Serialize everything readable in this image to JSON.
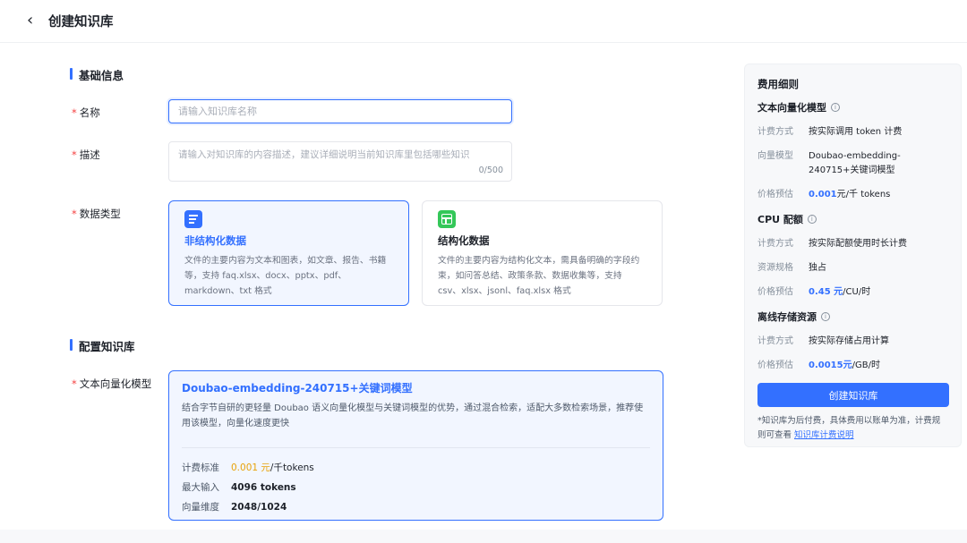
{
  "header": {
    "back_icon": "chevron-left-icon",
    "title": "创建知识库"
  },
  "basic_section": {
    "title": "基础信息"
  },
  "name_field": {
    "label": "名称",
    "value": "",
    "placeholder": "请输入知识库名称"
  },
  "desc_field": {
    "label": "描述",
    "value": "",
    "placeholder": "请输入对知识库的内容描述，建议详细说明当前知识库里包括哪些知识",
    "counter": "0/500"
  },
  "data_type": {
    "label": "数据类型",
    "options": [
      {
        "name": "非结构化数据",
        "desc": "文件的主要内容为文本和图表，如文章、报告、书籍等，支持 faq.xlsx、docx、pptx、pdf、markdown、txt 格式",
        "icon": "document-icon",
        "selected": true
      },
      {
        "name": "结构化数据",
        "desc": "文件的主要内容为结构化文本，需具备明确的字段约束，如问答总结、政策条款、数据收集等，支持 csv、xlsx、jsonl、faq.xlsx 格式",
        "icon": "table-icon",
        "selected": false
      }
    ]
  },
  "config_section": {
    "title": "配置知识库"
  },
  "model_field": {
    "label": "文本向量化模型",
    "name": "Doubao-embedding-240715+关键词模型",
    "desc": "结合字节自研的更轻量 Doubao 语义向量化模型与关键词模型的优势，通过混合检索，适配大多数检索场景，推荐使用该模型，向量化速度更快",
    "price_label": "计费标准",
    "price_value": "0.001 元",
    "price_unit": "/千tokens",
    "max_input_label": "最大输入",
    "max_input_value": "4096 tokens",
    "dimension_label": "向量维度",
    "dimension_value": "2048/1024"
  },
  "cost_panel": {
    "title": "费用细则",
    "text_model": {
      "title": "文本向量化模型",
      "billing_label": "计费方式",
      "billing_value": "按实际调用 token 计费",
      "model_label": "向量模型",
      "model_value": "Doubao-embedding-240715+关键词模型",
      "price_label": "价格预估",
      "price_value": "0.001",
      "price_unit": "元/千 tokens"
    },
    "cpu": {
      "title": "CPU 配额",
      "billing_label": "计费方式",
      "billing_value": "按实际配额使用时长计费",
      "spec_label": "资源规格",
      "spec_value": "独占",
      "price_label": "价格预估",
      "price_value": "0.45 元",
      "price_unit": "/CU/时"
    },
    "storage": {
      "title": "离线存储资源",
      "billing_label": "计费方式",
      "billing_value": "按实际存储占用计算",
      "price_label": "价格预估",
      "price_value": "0.0015元",
      "price_unit": "/GB/时"
    },
    "create_button": "创建知识库",
    "note": "*知识库为后付费，具体费用以账单为准，计费规则可查看",
    "note_link": "知识库计费说明"
  },
  "colors": {
    "accent": "#3370ff",
    "required": "#f53f3f",
    "price_orange": "#e8a20a",
    "structured_icon": "#34c759"
  }
}
